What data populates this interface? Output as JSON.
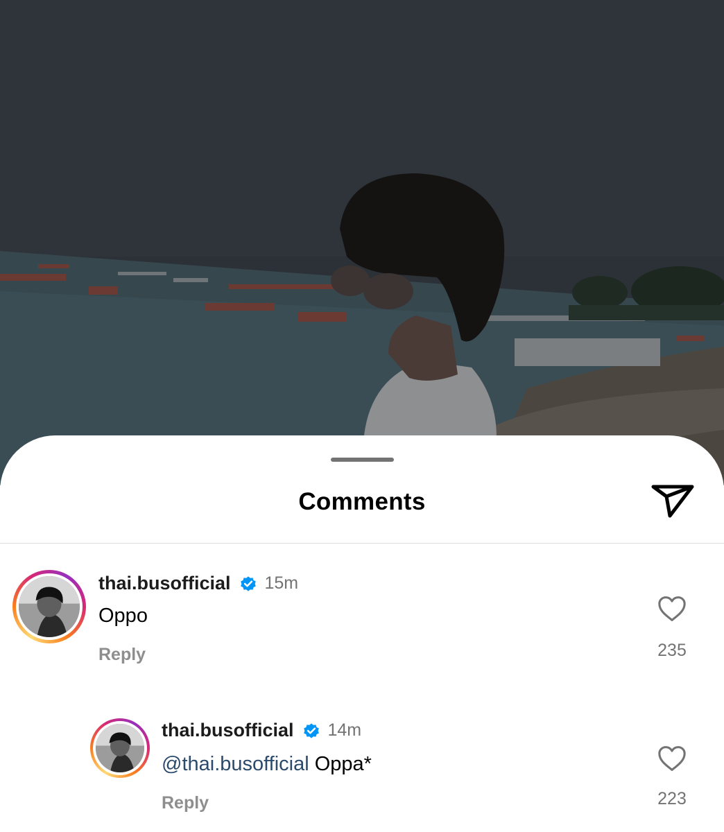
{
  "sheet": {
    "title": "Comments"
  },
  "icons": {
    "share": "send-icon",
    "like": "heart-outline-icon",
    "verified": "verified-badge-icon"
  },
  "colors": {
    "verified": "#0095f6",
    "mention": "#2c4a6b",
    "muted": "#737373"
  },
  "comments": [
    {
      "username": "thai.busofficial",
      "verified": true,
      "time": "15m",
      "mention": "",
      "text": "Oppo",
      "reply_label": "Reply",
      "likes": "235"
    },
    {
      "username": "thai.busofficial",
      "verified": true,
      "time": "14m",
      "mention": "@thai.busofficial",
      "text": " Oppa*",
      "reply_label": "Reply",
      "likes": "223"
    }
  ]
}
